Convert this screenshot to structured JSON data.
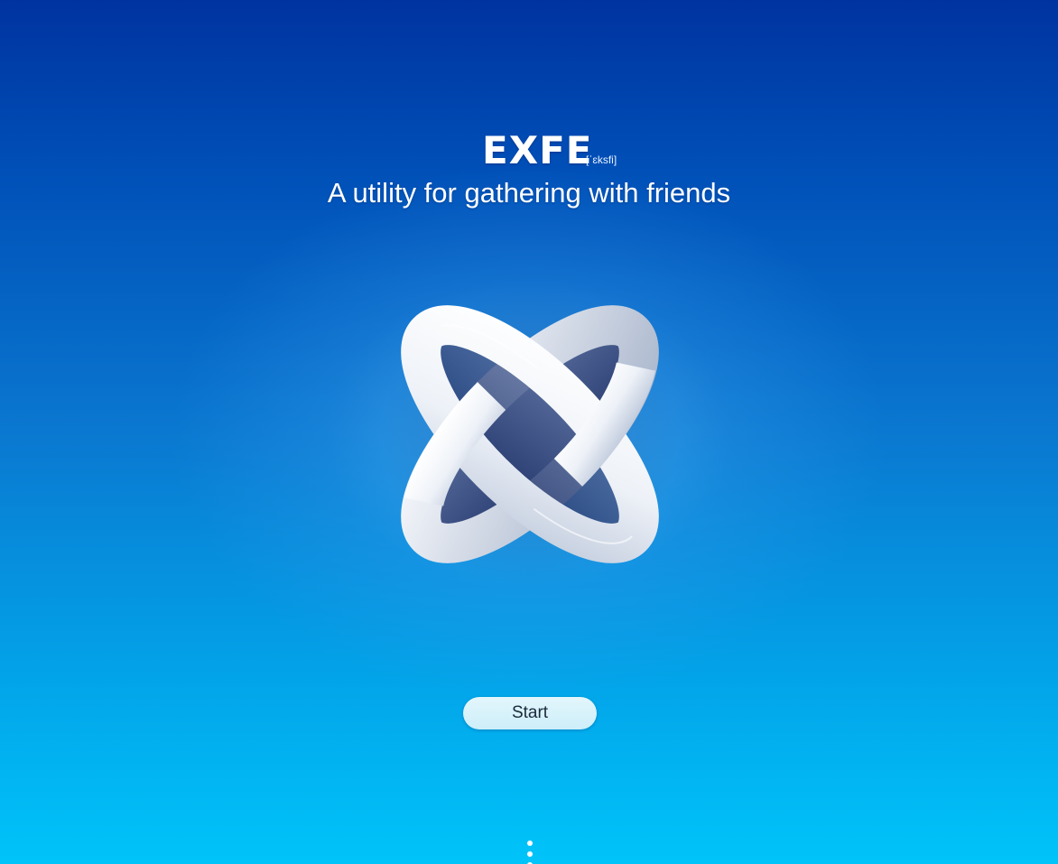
{
  "app": {
    "title": "EXFE",
    "phonetic": "[ˈɛksfi]",
    "tagline": "A utility for gathering with friends"
  },
  "logo": {
    "icon": "ribbon-x-logo-icon"
  },
  "actions": {
    "start_label": "Start"
  },
  "footer": {
    "more_icon": "vertical-dots-icon"
  },
  "colors": {
    "background_top": "#0033a0",
    "background_bottom": "#00c4fa",
    "button_fill": "#d6f2fb",
    "text": "#ffffff"
  }
}
